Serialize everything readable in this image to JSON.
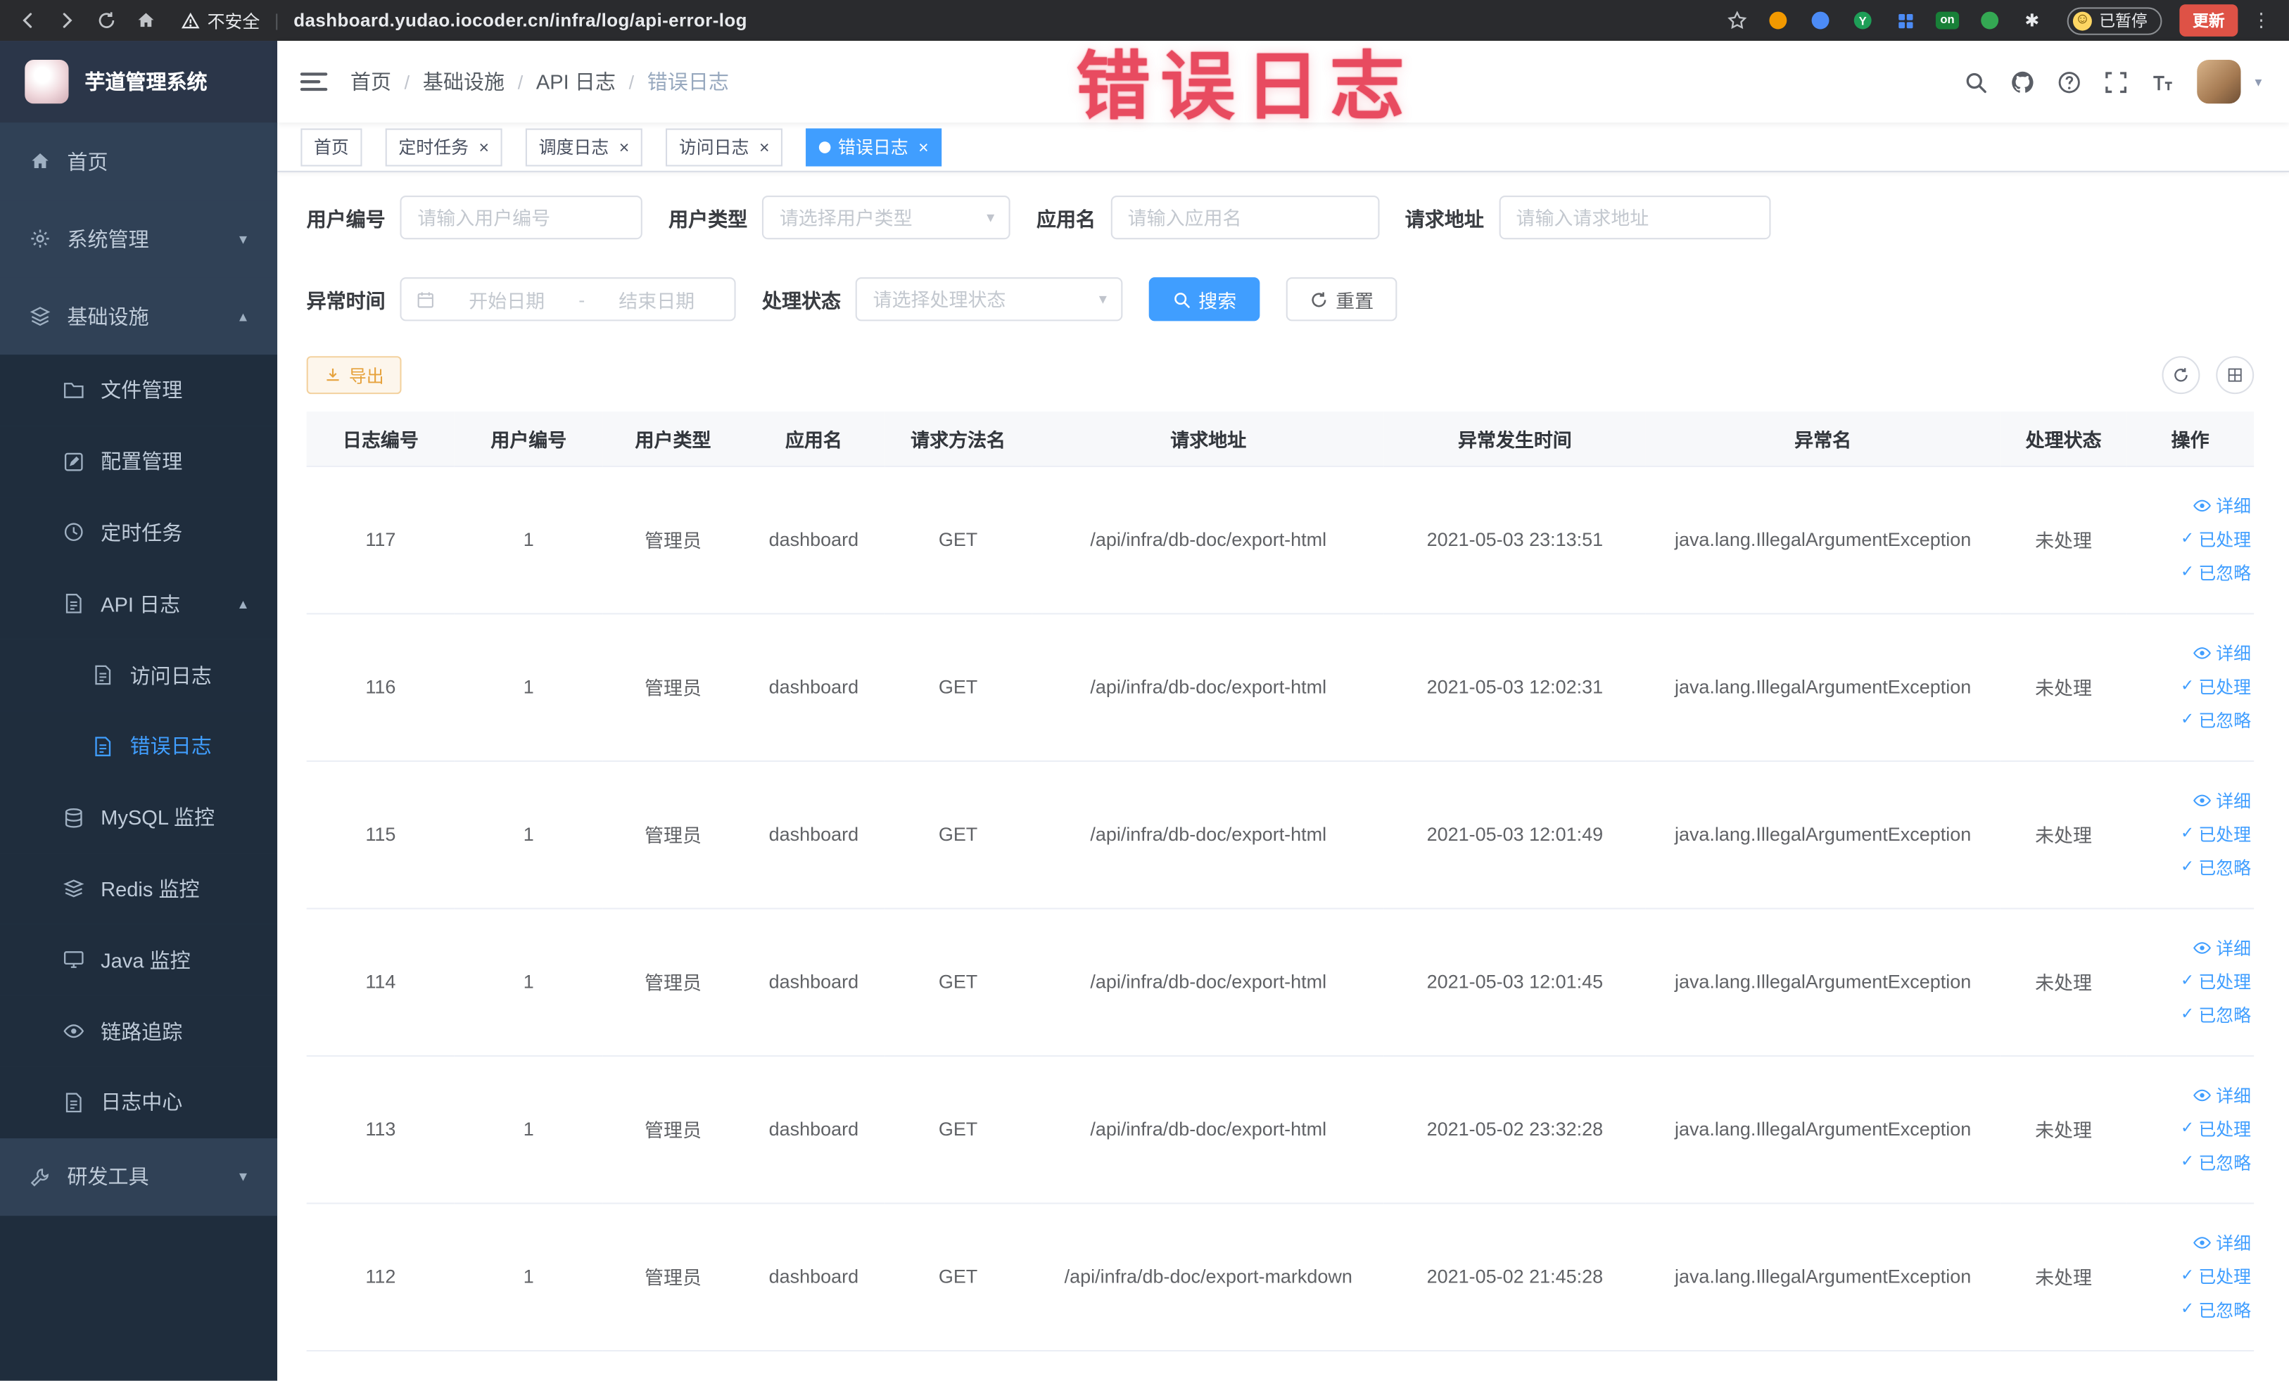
{
  "browser": {
    "security_label": "不安全",
    "url": "dashboard.yudao.iocoder.cn/infra/log/api-error-log",
    "extension_badge": "on",
    "paused_label": "已暂停",
    "update_label": "更新"
  },
  "watermark": "错误日志",
  "sidebar": {
    "logo_title": "芋道管理系统",
    "items": [
      {
        "label": "首页",
        "level": 1,
        "icon": "home"
      },
      {
        "label": "系统管理",
        "level": 1,
        "icon": "gear",
        "arrow": "down"
      },
      {
        "label": "基础设施",
        "level": 1,
        "icon": "layers",
        "arrow": "up"
      },
      {
        "label": "文件管理",
        "level": 2,
        "icon": "folder"
      },
      {
        "label": "配置管理",
        "level": 2,
        "icon": "edit"
      },
      {
        "label": "定时任务",
        "level": 2,
        "icon": "clock"
      },
      {
        "label": "API 日志",
        "level": 2,
        "icon": "doc",
        "arrow": "up"
      },
      {
        "label": "访问日志",
        "level": 3,
        "icon": "doc"
      },
      {
        "label": "错误日志",
        "level": 3,
        "icon": "doc",
        "active": true
      },
      {
        "label": "MySQL 监控",
        "level": 2,
        "icon": "db"
      },
      {
        "label": "Redis 监控",
        "level": 2,
        "icon": "redis"
      },
      {
        "label": "Java 监控",
        "level": 2,
        "icon": "monitor"
      },
      {
        "label": "链路追踪",
        "level": 2,
        "icon": "eye"
      },
      {
        "label": "日志中心",
        "level": 2,
        "icon": "doc"
      },
      {
        "label": "研发工具",
        "level": 1,
        "icon": "tools",
        "arrow": "down"
      }
    ]
  },
  "header": {
    "breadcrumb": [
      "首页",
      "基础设施",
      "API 日志",
      "错误日志"
    ],
    "breadcrumb_separator": "/"
  },
  "tabs": [
    {
      "label": "首页",
      "closable": false,
      "active": false
    },
    {
      "label": "定时任务",
      "closable": true,
      "active": false
    },
    {
      "label": "调度日志",
      "closable": true,
      "active": false
    },
    {
      "label": "访问日志",
      "closable": true,
      "active": false
    },
    {
      "label": "错误日志",
      "closable": true,
      "active": true
    }
  ],
  "filters": {
    "user_id": {
      "label": "用户编号",
      "placeholder": "请输入用户编号"
    },
    "user_type": {
      "label": "用户类型",
      "placeholder": "请选择用户类型"
    },
    "app_name": {
      "label": "应用名",
      "placeholder": "请输入应用名"
    },
    "request_url": {
      "label": "请求地址",
      "placeholder": "请输入请求地址"
    },
    "exception_time": {
      "label": "异常时间",
      "start_placeholder": "开始日期",
      "separator": "-",
      "end_placeholder": "结束日期"
    },
    "process_status": {
      "label": "处理状态",
      "placeholder": "请选择处理状态"
    },
    "search_label": "搜索",
    "reset_label": "重置"
  },
  "toolbar": {
    "export_label": "导出"
  },
  "table": {
    "columns": [
      "日志编号",
      "用户编号",
      "用户类型",
      "应用名",
      "请求方法名",
      "请求地址",
      "异常发生时间",
      "异常名",
      "处理状态",
      "操作"
    ],
    "row_actions": [
      "详细",
      "已处理",
      "已忽略"
    ],
    "rows": [
      [
        "117",
        "1",
        "管理员",
        "dashboard",
        "GET",
        "/api/infra/db-doc/export-html",
        "2021-05-03 23:13:51",
        "java.lang.IllegalArgumentException",
        "未处理"
      ],
      [
        "116",
        "1",
        "管理员",
        "dashboard",
        "GET",
        "/api/infra/db-doc/export-html",
        "2021-05-03 12:02:31",
        "java.lang.IllegalArgumentException",
        "未处理"
      ],
      [
        "115",
        "1",
        "管理员",
        "dashboard",
        "GET",
        "/api/infra/db-doc/export-html",
        "2021-05-03 12:01:49",
        "java.lang.IllegalArgumentException",
        "未处理"
      ],
      [
        "114",
        "1",
        "管理员",
        "dashboard",
        "GET",
        "/api/infra/db-doc/export-html",
        "2021-05-03 12:01:45",
        "java.lang.IllegalArgumentException",
        "未处理"
      ],
      [
        "113",
        "1",
        "管理员",
        "dashboard",
        "GET",
        "/api/infra/db-doc/export-html",
        "2021-05-02 23:32:28",
        "java.lang.IllegalArgumentException",
        "未处理"
      ],
      [
        "112",
        "1",
        "管理员",
        "dashboard",
        "GET",
        "/api/infra/db-doc/export-markdown",
        "2021-05-02 21:45:28",
        "java.lang.IllegalArgumentException",
        "未处理"
      ]
    ]
  },
  "colors": {
    "accent": "#409eff",
    "warning": "#e6a23c",
    "sidebar_bg": "#304156",
    "submenu_bg": "#1f2d3d"
  }
}
